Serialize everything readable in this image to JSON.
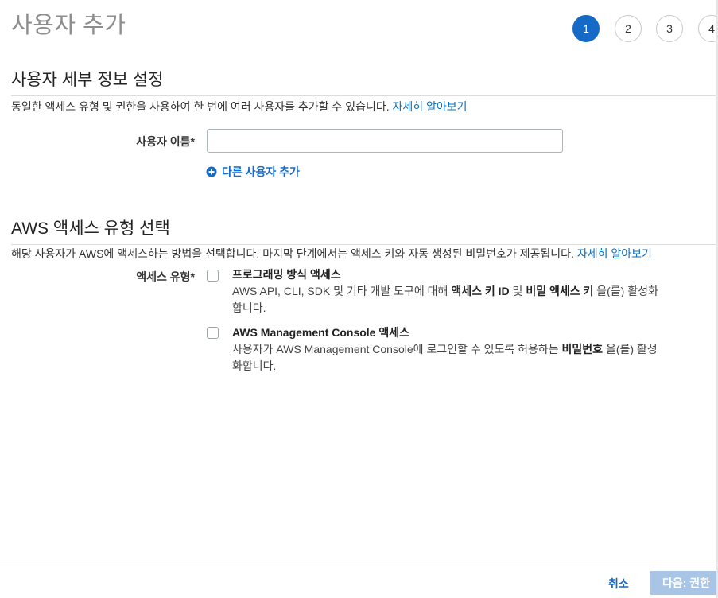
{
  "page": {
    "title": "사용자 추가"
  },
  "stepper": {
    "steps": [
      "1",
      "2",
      "3",
      "4"
    ],
    "active_index": 0
  },
  "user_details": {
    "heading": "사용자 세부 정보 설정",
    "description": "동일한 액세스 유형 및 권한을 사용하여 한 번에 여러 사용자를 추가할 수 있습니다.",
    "learn_more": "자세히 알아보기",
    "username_label": "사용자 이름*",
    "username_value": "",
    "add_user_label": "다른 사용자 추가"
  },
  "access_type": {
    "heading": "AWS 액세스 유형 선택",
    "description": "해당 사용자가 AWS에 액세스하는 방법을 선택합니다. 마지막 단계에서는 액세스 키와 자동 생성된 비밀번호가 제공됩니다.",
    "learn_more": "자세히 알아보기",
    "label": "액세스 유형*",
    "options": [
      {
        "title": "프로그래밍 방식 액세스",
        "desc_pre": "AWS API, CLI, SDK 및 기타 개발 도구에 대해 ",
        "bold1": "액세스 키 ID",
        "mid": " 및 ",
        "bold2": "비밀 액세스 키",
        "desc_post": " 을(를) 활성화합니다.",
        "checked": false
      },
      {
        "title": "AWS Management Console 액세스",
        "desc_pre": "사용자가 AWS Management Console에 로그인할 수 있도록 허용하는 ",
        "bold1": "비밀번호",
        "desc_post": " 을(를) 활성화합니다.",
        "checked": false
      }
    ]
  },
  "footer": {
    "cancel_label": "취소",
    "next_label": "다음: 권한"
  },
  "colors": {
    "accent": "#1569c7",
    "link": "#0a6fbf",
    "next_disabled": "#a9c5e6"
  }
}
